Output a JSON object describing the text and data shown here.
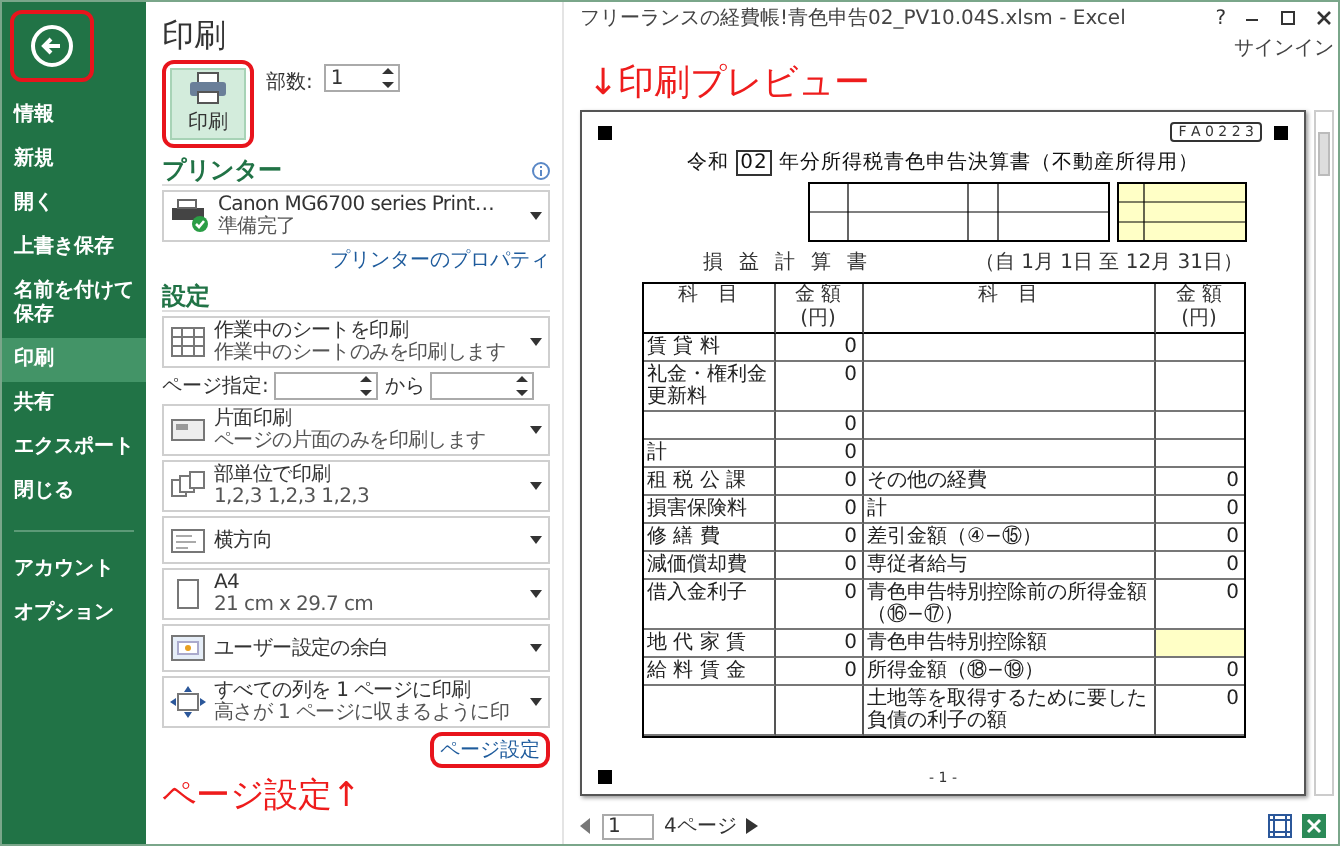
{
  "window": {
    "title": "フリーランスの経費帳!青色申告02_PV10.04S.xlsm - Excel",
    "help": "?",
    "sign_in": "サインイン"
  },
  "sidebar": {
    "items": [
      {
        "label": "情報",
        "selected": false
      },
      {
        "label": "新規",
        "selected": false
      },
      {
        "label": "開く",
        "selected": false
      },
      {
        "label": "上書き保存",
        "selected": false
      },
      {
        "label": "名前を付けて保存",
        "selected": false
      },
      {
        "label": "印刷",
        "selected": true
      },
      {
        "label": "共有",
        "selected": false
      },
      {
        "label": "エクスポート",
        "selected": false
      },
      {
        "label": "閉じる",
        "selected": false
      }
    ],
    "footer_items": [
      {
        "label": "アカウント",
        "selected": false
      },
      {
        "label": "オプション",
        "selected": false
      }
    ]
  },
  "print_panel": {
    "heading": "印刷",
    "print_button": "印刷",
    "copies_label": "部数:",
    "copies_value": "1",
    "printer": {
      "heading": "プリンター",
      "name": "Canon MG6700 series Print…",
      "status": "準備完了",
      "properties_link": "プリンターのプロパティ"
    },
    "settings": {
      "heading": "設定",
      "options": [
        {
          "title": "作業中のシートを印刷",
          "subtitle": "作業中のシートのみを印刷します"
        },
        {
          "title": "片面印刷",
          "subtitle": "ページの片面のみを印刷します"
        },
        {
          "title": "部単位で印刷",
          "subtitle": "1,2,3   1,2,3   1,2,3"
        },
        {
          "title": "横方向"
        },
        {
          "title": "A4",
          "subtitle": "21 cm x 29.7 cm"
        },
        {
          "title": "ユーザー設定の余白"
        },
        {
          "title": "すべての列を 1 ページに印刷",
          "subtitle": "高さが 1 ページに収まるように印"
        }
      ],
      "page_range": {
        "label": "ページ指定:",
        "to_label": "から"
      }
    },
    "page_setup_link": "ページ設定"
  },
  "annotations": {
    "preview": "↓印刷プレビュー",
    "page_setup": "ページ設定↑"
  },
  "preview": {
    "page": {
      "form_code": "F A 0 2 2 3",
      "title_era": "令和",
      "title_year": "02",
      "title": "年分所得税青色申告決算書",
      "title_note": "（不動産所得用）",
      "statement_heading": "損益計算書",
      "period": "（自 1月 1日 至 12月 31日）",
      "columns": [
        "科　目",
        "金 額 (円)",
        "科　目",
        "金 額 (円)"
      ],
      "rows": [
        {
          "left_label": "賃 貸 料",
          "left_amount": "0"
        },
        {
          "left_label": "礼金・権利金更新料",
          "left_amount": "0"
        },
        {
          "left_amount": "0"
        },
        {
          "left_label": "計",
          "left_amount": "0"
        },
        {
          "left_label": "租 税 公 課",
          "left_amount": "0",
          "right_label": "その他の経費",
          "right_amount": "0"
        },
        {
          "left_label": "損害保険料",
          "left_amount": "0",
          "right_label": "計",
          "right_amount": "0"
        },
        {
          "left_label": "修 繕 費",
          "left_amount": "0",
          "right_label": "差引金額（④−⑮）",
          "right_amount": "0"
        },
        {
          "left_label": "減価償却費",
          "left_amount": "0",
          "right_label": "専従者給与",
          "right_amount": "0"
        },
        {
          "left_label": "借入金利子",
          "left_amount": "0",
          "right_label": "青色申告特別控除前の所得金額（⑯−⑰）",
          "right_amount": "0"
        },
        {
          "left_label": "地 代 家 賃",
          "left_amount": "0",
          "right_label": "青色申告特別控除額",
          "right_editable": true
        },
        {
          "left_label": "給 料 賃 金",
          "left_amount": "0",
          "right_label": "所得金額（⑱−⑲）",
          "right_amount": "0"
        },
        {
          "right_label": "土地等を取得するために要した負債の利子の額",
          "right_amount": "0"
        }
      ],
      "page_number": "- 1 -"
    },
    "page_input": "1",
    "page_count": "4ページ"
  }
}
